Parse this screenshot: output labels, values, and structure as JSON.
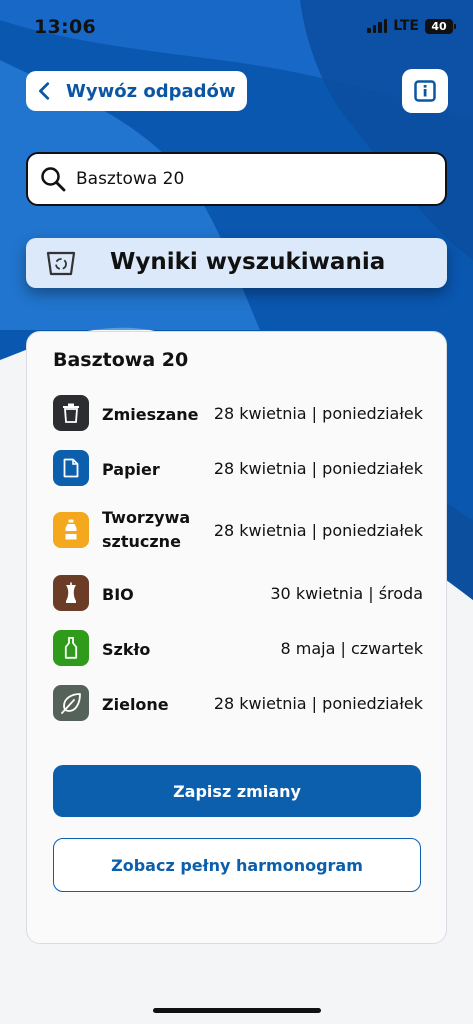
{
  "status": {
    "time": "13:06",
    "network": "LTE",
    "battery": "40"
  },
  "header": {
    "back_label": "Wywóz odpadów",
    "info_icon": "info-icon"
  },
  "search": {
    "value": "Basztowa 20",
    "icon": "search-icon"
  },
  "results": {
    "title": "Wyniki wyszukiwania",
    "icon": "recycle-bin-icon"
  },
  "card": {
    "address": "Basztowa 20",
    "items": [
      {
        "name": "Zmieszane",
        "date": "28 kwietnia | poniedziałek",
        "icon": "trash-icon",
        "color": "#2b2d31"
      },
      {
        "name": "Papier",
        "date": "28 kwietnia | poniedziałek",
        "icon": "document-icon",
        "color": "#0b5fad"
      },
      {
        "name": "Tworzywa sztuczne",
        "date": "28 kwietnia | poniedziałek",
        "icon": "bottle-icon",
        "color": "#f4a81d"
      },
      {
        "name": "BIO",
        "date": "30 kwietnia | środa",
        "icon": "apple-core-icon",
        "color": "#6b3d26"
      },
      {
        "name": "Szkło",
        "date": "8 maja | czwartek",
        "icon": "glass-bottle-icon",
        "color": "#2e9b1a"
      },
      {
        "name": "Zielone",
        "date": "28 kwietnia | poniedziałek",
        "icon": "leaf-icon",
        "color": "#54625a"
      }
    ],
    "save_label": "Zapisz zmiany",
    "schedule_label": "Zobacz pełny harmonogram"
  }
}
